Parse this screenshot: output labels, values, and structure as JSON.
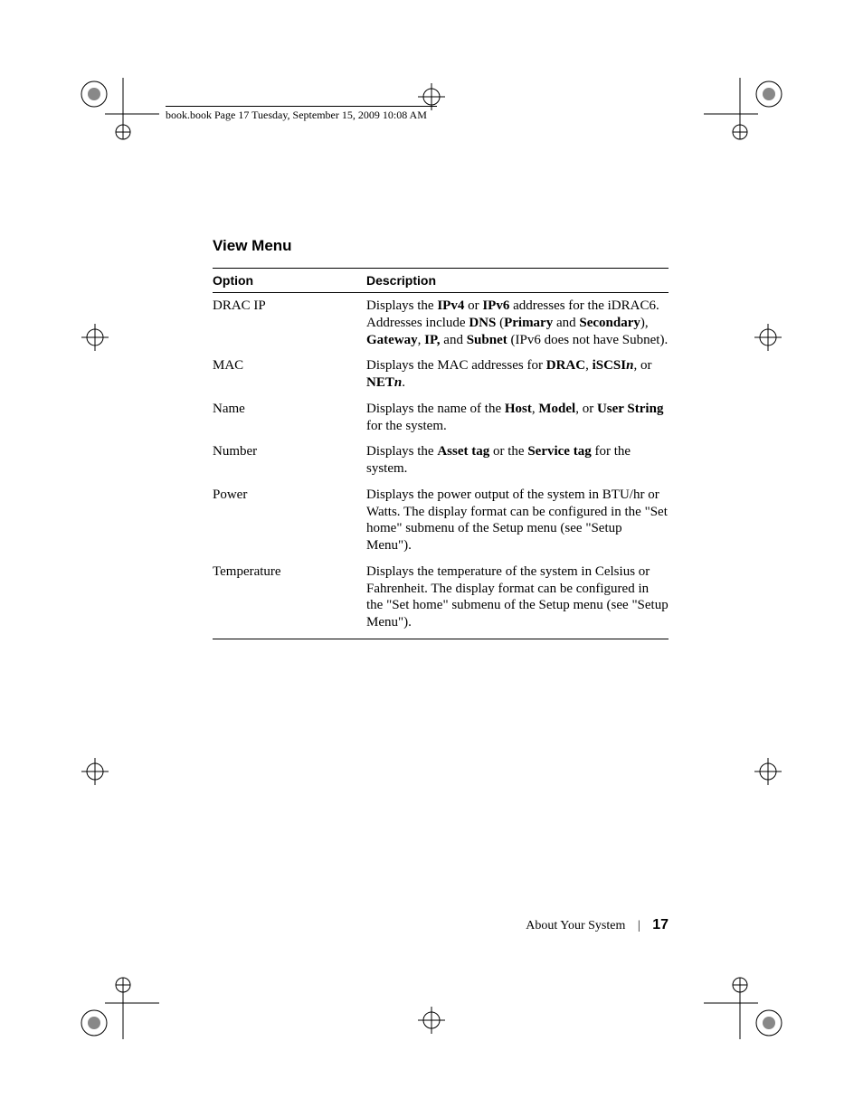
{
  "running_header": "book.book  Page 17  Tuesday, September 15, 2009  10:08 AM",
  "section_title": "View Menu",
  "table": {
    "headers": {
      "option": "Option",
      "description": "Description"
    },
    "rows": [
      {
        "option": "DRAC IP",
        "desc_pre": "Displays the ",
        "b1": "IPv4",
        "mid1": " or ",
        "b2": "IPv6",
        "mid2": " addresses for the iDRAC6. Addresses include ",
        "b3": "DNS",
        "mid3": " (",
        "b4": "Primary",
        "mid4": " and ",
        "b5": "Secondary",
        "mid5": "), ",
        "b6": "Gateway",
        "mid6": ", ",
        "b7": "IP,",
        "mid7": " and ",
        "b8": "Subnet",
        "tail": " (IPv6 does not have Subnet)."
      },
      {
        "option": "MAC",
        "desc_pre": "Displays the MAC addresses for ",
        "b1": "DRAC",
        "mid1": ", ",
        "b2": "iSCSI",
        "i1": "n",
        "mid2": ", or ",
        "b3": "NET",
        "i2": "n",
        "tail": "."
      },
      {
        "option": "Name",
        "desc_pre": "Displays the name of the ",
        "b1": "Host",
        "mid1": ", ",
        "b2": "Model",
        "mid2": ", or ",
        "b3": "User String",
        "tail": " for the system."
      },
      {
        "option": "Number",
        "desc_pre": "Displays the ",
        "b1": "Asset tag",
        "mid1": " or the ",
        "b2": "Service tag",
        "tail": " for the system."
      },
      {
        "option": "Power",
        "desc_full": "Displays the power output of the system in BTU/hr or Watts. The display format can be configured in the \"Set home\" submenu of the Setup menu (see \"Setup Menu\")."
      },
      {
        "option": "Temperature",
        "desc_full": "Displays the temperature of the system in Celsius or Fahrenheit. The display format can be configured in the \"Set home\" submenu of the Setup menu (see \"Setup Menu\")."
      }
    ]
  },
  "footer": {
    "section": "About Your System",
    "page": "17"
  }
}
